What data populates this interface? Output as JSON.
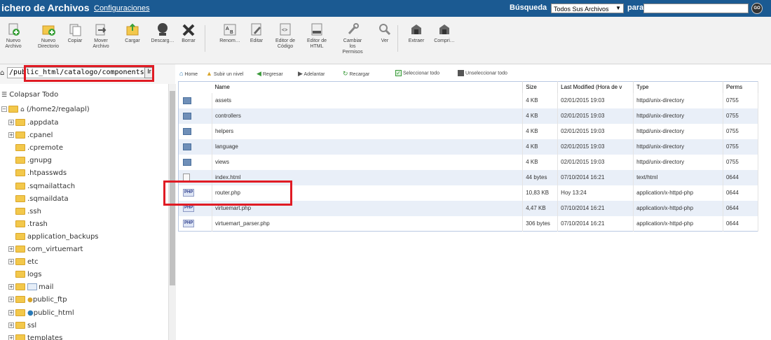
{
  "header": {
    "title": "ichero de Archivos",
    "settings_link": "Configuraciones",
    "search_label": "Búsqueda",
    "search_scope": "Todos Sus Archivos",
    "search_for": "para",
    "search_value": "",
    "go_label": "GO"
  },
  "toolbar": {
    "items": [
      {
        "label": "Nuevo\nArchivo",
        "icon": "new-file-icon"
      },
      {
        "label": "Nuevo\nDirectorio",
        "icon": "new-folder-icon"
      },
      {
        "label": "Copiar",
        "icon": "copy-icon"
      },
      {
        "label": "Mover\nArchivo",
        "icon": "move-icon"
      },
      {
        "label": "Cargar",
        "icon": "upload-icon"
      },
      {
        "label": "Descarg…",
        "icon": "download-icon"
      },
      {
        "label": "Borrar",
        "icon": "delete-icon"
      },
      {
        "label": "Renom…",
        "icon": "rename-icon"
      },
      {
        "label": "Editar",
        "icon": "edit-icon"
      },
      {
        "label": "Editor de\nCódigo",
        "icon": "code-editor-icon"
      },
      {
        "label": "Editor de\nHTML",
        "icon": "html-editor-icon"
      },
      {
        "label": "Cambiar\nlos\nPermisos",
        "icon": "permissions-icon"
      },
      {
        "label": "Ver",
        "icon": "view-icon"
      },
      {
        "label": "Extraer",
        "icon": "extract-icon"
      },
      {
        "label": "Compri…",
        "icon": "compress-icon"
      }
    ]
  },
  "path": {
    "value": "/public_html/catalogo/components/com_",
    "go_label": "Ir"
  },
  "nav": {
    "home": "Home",
    "up": "Subir un nivel",
    "back": "Regresar",
    "forward": "Adelantar",
    "reload": "Recargar",
    "select_all": "Seleccionar todo",
    "unselect_all": "Unseleccionar todo"
  },
  "tree": {
    "collapse": "Colapsar Todo",
    "root": "(/home2/regalapl)",
    "items": [
      ".appdata",
      ".cpanel",
      ".cpremote",
      ".gnupg",
      ".htpasswds",
      ".sqmailattach",
      ".sqmaildata",
      ".ssh",
      ".trash",
      "application_backups",
      "com_virtuemart",
      "etc",
      "logs",
      "mail",
      "public_ftp",
      "public_html",
      "ssl",
      "templates"
    ]
  },
  "table": {
    "headers": [
      "Name",
      "Size",
      "Last Modified (Hora de v",
      "Type",
      "Perms"
    ],
    "rows": [
      {
        "name": "assets",
        "size": "4 KB",
        "modified": "02/01/2015 19:03",
        "type": "httpd/unix-directory",
        "perms": "0755",
        "kind": "folder"
      },
      {
        "name": "controllers",
        "size": "4 KB",
        "modified": "02/01/2015 19:03",
        "type": "httpd/unix-directory",
        "perms": "0755",
        "kind": "folder"
      },
      {
        "name": "helpers",
        "size": "4 KB",
        "modified": "02/01/2015 19:03",
        "type": "httpd/unix-directory",
        "perms": "0755",
        "kind": "folder"
      },
      {
        "name": "language",
        "size": "4 KB",
        "modified": "02/01/2015 19:03",
        "type": "httpd/unix-directory",
        "perms": "0755",
        "kind": "folder"
      },
      {
        "name": "views",
        "size": "4 KB",
        "modified": "02/01/2015 19:03",
        "type": "httpd/unix-directory",
        "perms": "0755",
        "kind": "folder"
      },
      {
        "name": "index.html",
        "size": "44 bytes",
        "modified": "07/10/2014 16:21",
        "type": "text/html",
        "perms": "0644",
        "kind": "doc"
      },
      {
        "name": "router.php",
        "size": "10,83 KB",
        "modified": "Hoy 13:24",
        "type": "application/x-httpd-php",
        "perms": "0644",
        "kind": "php"
      },
      {
        "name": "virtuemart.php",
        "size": "4,47 KB",
        "modified": "07/10/2014 16:21",
        "type": "application/x-httpd-php",
        "perms": "0644",
        "kind": "php"
      },
      {
        "name": "virtuemart_parser.php",
        "size": "306 bytes",
        "modified": "07/10/2014 16:21",
        "type": "application/x-httpd-php",
        "perms": "0644",
        "kind": "php"
      }
    ]
  },
  "colors": {
    "header_bg": "#1b5a92",
    "highlight": "#e01b24",
    "row_alt": "#e9eff8"
  }
}
